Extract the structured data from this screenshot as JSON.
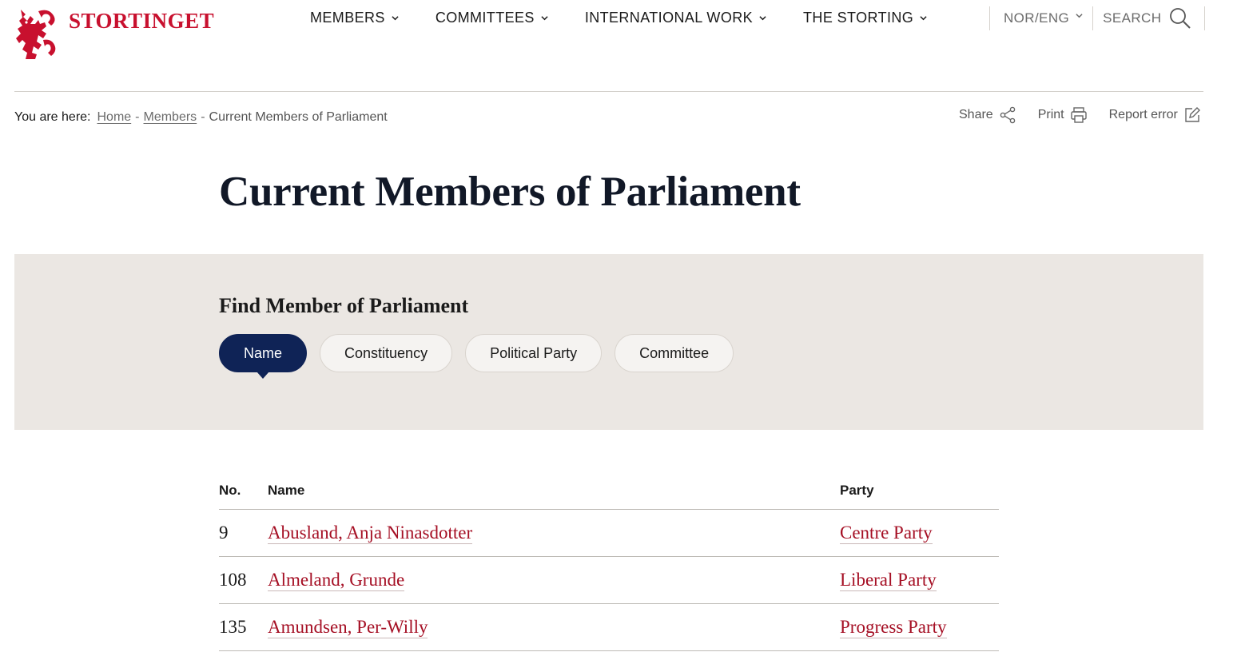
{
  "brand": {
    "name": "STORTINGET",
    "color": "#c8102e",
    "icon": "lion-coat-of-arms-icon"
  },
  "nav": [
    {
      "label": "MEMBERS"
    },
    {
      "label": "COMMITTEES"
    },
    {
      "label": "INTERNATIONAL WORK"
    },
    {
      "label": "THE STORTING"
    }
  ],
  "utility": {
    "language_label": "NOR/ENG",
    "search_label": "SEARCH"
  },
  "breadcrumb": {
    "prefix": "You are here:",
    "items": [
      "Home",
      "Members"
    ],
    "separator": "-",
    "current": "Current Members of Parliament"
  },
  "tools": {
    "share": "Share",
    "print": "Print",
    "report": "Report error"
  },
  "page_title": "Current Members of Parliament",
  "find": {
    "heading": "Find Member of Parliament",
    "tabs": [
      "Name",
      "Constituency",
      "Political Party",
      "Committee"
    ],
    "active_tab": "Name"
  },
  "table": {
    "headers": {
      "no": "No.",
      "name": "Name",
      "party": "Party"
    },
    "rows": [
      {
        "no": "9",
        "name": "Abusland, Anja Ninasdotter",
        "party": "Centre Party"
      },
      {
        "no": "108",
        "name": "Almeland, Grunde",
        "party": "Liberal Party"
      },
      {
        "no": "135",
        "name": "Amundsen, Per-Willy",
        "party": "Progress Party"
      }
    ]
  },
  "colors": {
    "accent": "#a50f24",
    "navy": "#0f2356",
    "panel": "#ebe7e3"
  }
}
